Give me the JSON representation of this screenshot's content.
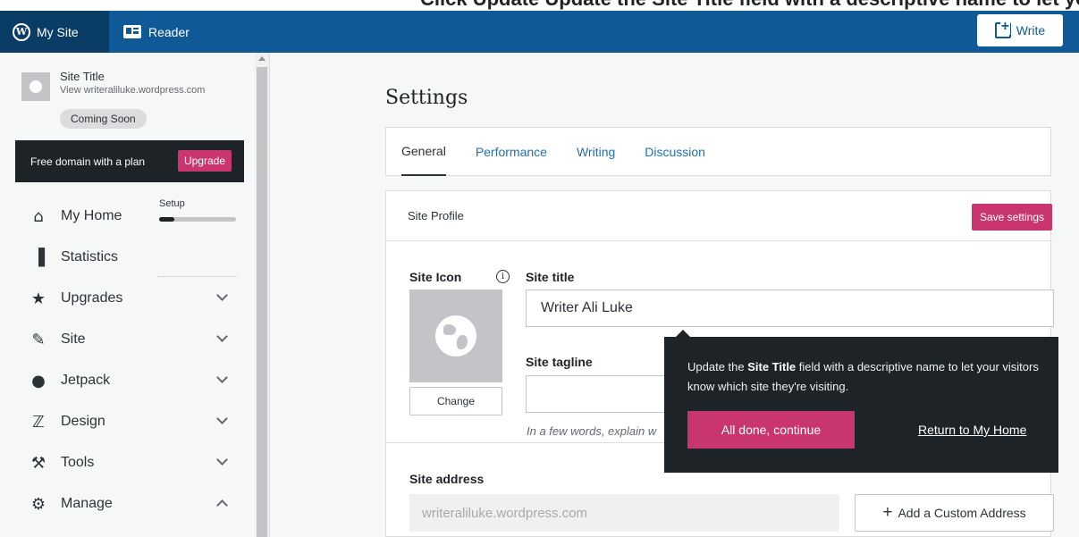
{
  "caption": "Click Update Update the Site Title field with a descriptive name to let your visitors know which site they're visiting.",
  "masterbar": {
    "my_site": "My Site",
    "reader": "Reader",
    "write": "Write"
  },
  "sidebar": {
    "site_title": "Site Title",
    "site_url": "View writeraliluke.wordpress.com",
    "badge": "Coming Soon",
    "domain_banner": "Free domain with a plan",
    "upgrade": "Upgrade",
    "setup_label": "Setup",
    "setup_progress": 0.2,
    "items": [
      {
        "label": "My Home",
        "icon": "home-icon"
      },
      {
        "label": "Statistics",
        "icon": "stats-icon"
      },
      {
        "label": "Upgrades",
        "icon": "star-icon"
      },
      {
        "label": "Site",
        "icon": "pencil-icon"
      },
      {
        "label": "Jetpack",
        "icon": "jetpack-icon"
      },
      {
        "label": "Design",
        "icon": "design-icon"
      },
      {
        "label": "Tools",
        "icon": "wrench-icon"
      },
      {
        "label": "Manage",
        "icon": "gear-icon"
      }
    ]
  },
  "main": {
    "page_title": "Settings",
    "tabs": [
      "General",
      "Performance",
      "Writing",
      "Discussion"
    ],
    "card_header": "Site Profile",
    "save_label": "Save settings",
    "site_icon_label": "Site Icon",
    "info_glyph": "i",
    "change_label": "Change",
    "site_title_label": "Site title",
    "site_title_value": "Writer Ali Luke",
    "site_tagline_label": "Site tagline",
    "site_tagline_value": "",
    "tagline_hint": "In a few words, explain w",
    "site_address_label": "Site address",
    "site_address_value": "writeraliluke.wordpress.com",
    "add_custom_address": "Add a Custom Address",
    "add_glyph": "+"
  },
  "tooltip": {
    "text_before": "Update the ",
    "text_bold": "Site Title",
    "text_after": " field with a descriptive name to let your visitors know which site they're visiting.",
    "primary": "All done, continue",
    "link": "Return to My Home"
  },
  "colors": {
    "masterbar": "#0f5a96",
    "accent_pink": "#c9356e",
    "link_blue": "#2271b1",
    "tooltip_bg": "#1d2327"
  }
}
